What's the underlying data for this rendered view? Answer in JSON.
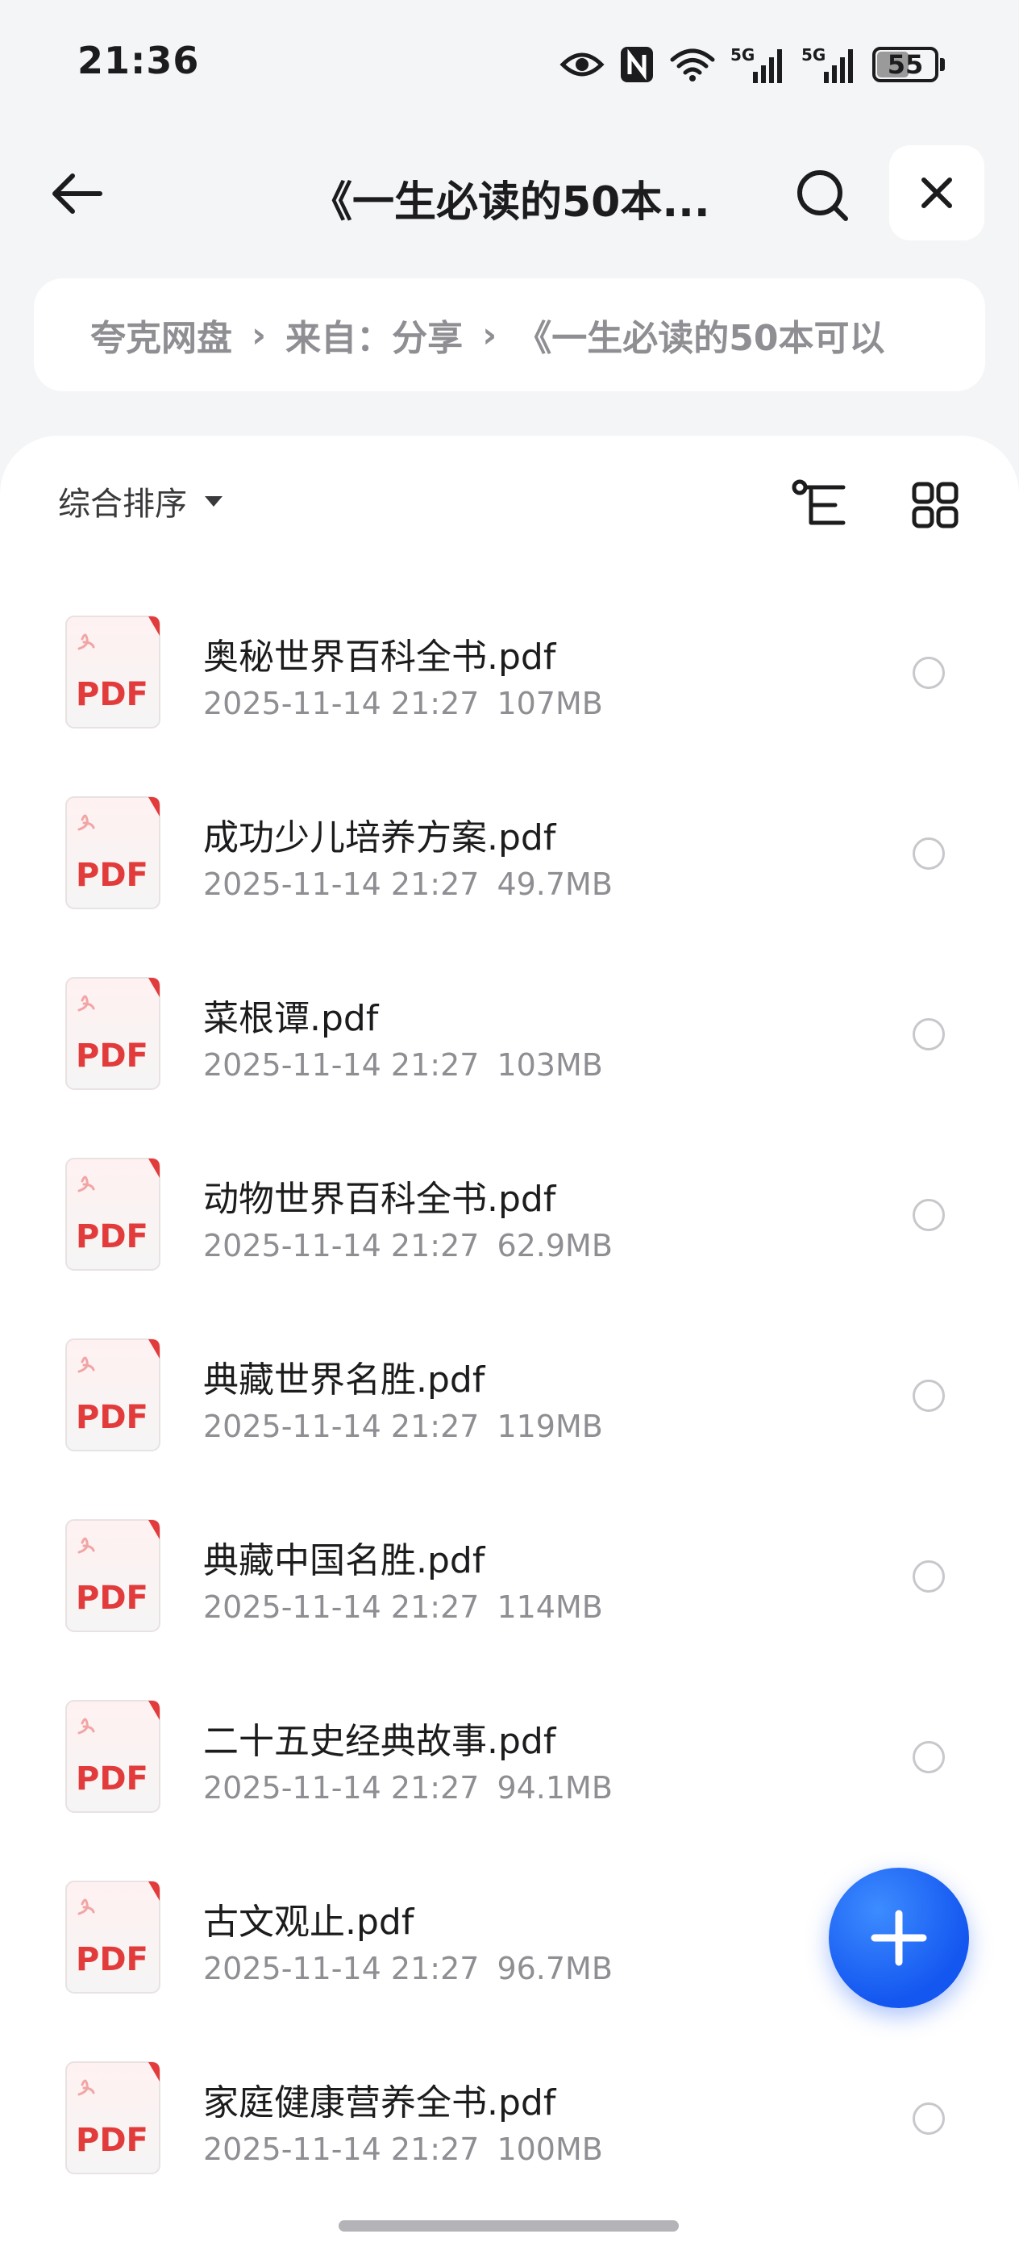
{
  "status_bar": {
    "time": "21:36",
    "battery_level": "55",
    "battery_fraction": 0.55,
    "icons": [
      "eye-icon",
      "nfc-icon",
      "wifi-icon",
      "5g-signal-icon",
      "5g-signal-icon",
      "battery-icon"
    ]
  },
  "header": {
    "title": "《一生必读的50本...",
    "back_icon": "arrow-left-icon",
    "search_icon": "search-icon",
    "close_icon": "close-icon"
  },
  "breadcrumb": {
    "items": [
      "夸克网盘",
      "来自：分享",
      "《一生必读的50本可以"
    ],
    "separator": "›"
  },
  "toolbar": {
    "sort_label": "综合排序",
    "sort_icon": "caret-down-icon",
    "tree_view_icon": "tree-view-icon",
    "grid_view_icon": "grid-view-icon"
  },
  "files": [
    {
      "name": "奥秘世界百科全书.pdf",
      "date": "2025-11-14 21:27",
      "size": "107MB"
    },
    {
      "name": "成功少儿培养方案.pdf",
      "date": "2025-11-14 21:27",
      "size": "49.7MB"
    },
    {
      "name": "菜根谭.pdf",
      "date": "2025-11-14 21:27",
      "size": "103MB"
    },
    {
      "name": "动物世界百科全书.pdf",
      "date": "2025-11-14 21:27",
      "size": "62.9MB"
    },
    {
      "name": "典藏世界名胜.pdf",
      "date": "2025-11-14 21:27",
      "size": "119MB"
    },
    {
      "name": "典藏中国名胜.pdf",
      "date": "2025-11-14 21:27",
      "size": "114MB"
    },
    {
      "name": "二十五史经典故事.pdf",
      "date": "2025-11-14 21:27",
      "size": "94.1MB"
    },
    {
      "name": "古文观止.pdf",
      "date": "2025-11-14 21:27",
      "size": "96.7MB"
    },
    {
      "name": "家庭健康营养全书.pdf",
      "date": "2025-11-14 21:27",
      "size": "100MB"
    }
  ],
  "file_icon": {
    "label": "PDF",
    "accent": "#e23b3b"
  },
  "fab": {
    "icon": "plus-icon",
    "color": "#1356f0"
  }
}
